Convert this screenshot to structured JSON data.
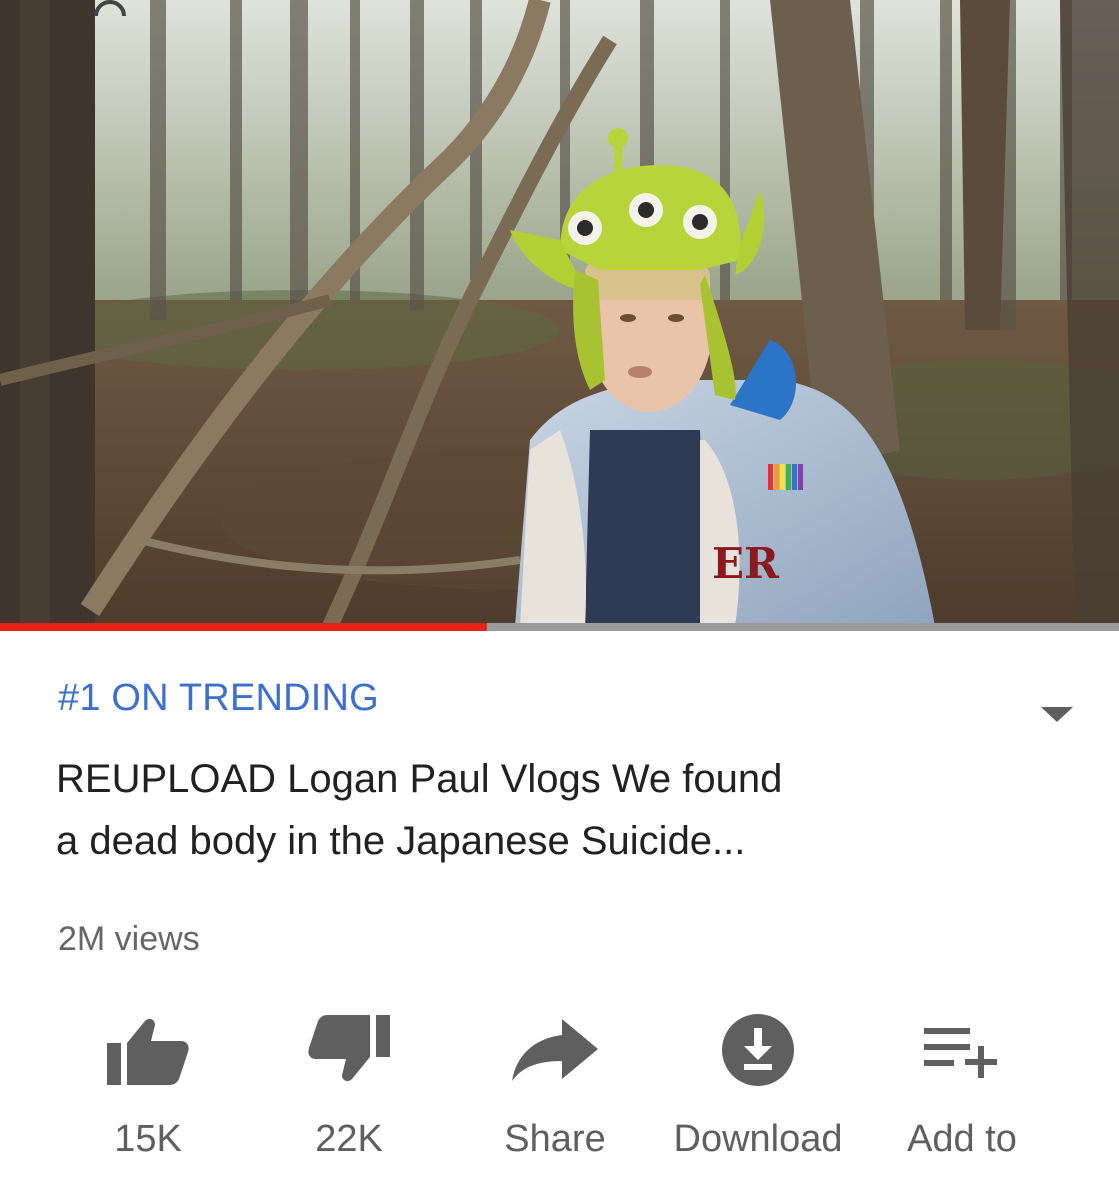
{
  "video": {
    "progress_fraction": 0.435,
    "badge_text": "ER",
    "colors": {
      "progress_played": "#e62117",
      "progress_track": "#9b9b9b"
    }
  },
  "info": {
    "trending_label": "#1 ON TRENDING",
    "title_line1": "REUPLOAD Logan Paul Vlogs We found",
    "title_line2": "a dead body in the Japanese Suicide...",
    "views": "2M views",
    "menu_icon": "chevron-down-icon"
  },
  "actions": [
    {
      "icon": "thumbs-up-icon",
      "label": "15K"
    },
    {
      "icon": "thumbs-down-icon",
      "label": "22K"
    },
    {
      "icon": "share-arrow-icon",
      "label": "Share"
    },
    {
      "icon": "download-icon",
      "label": "Download"
    },
    {
      "icon": "add-to-playlist-icon",
      "label": "Add to"
    }
  ],
  "colors": {
    "accent": "#3d6fcc",
    "text": "#212121",
    "muted": "#5f5f5f"
  }
}
